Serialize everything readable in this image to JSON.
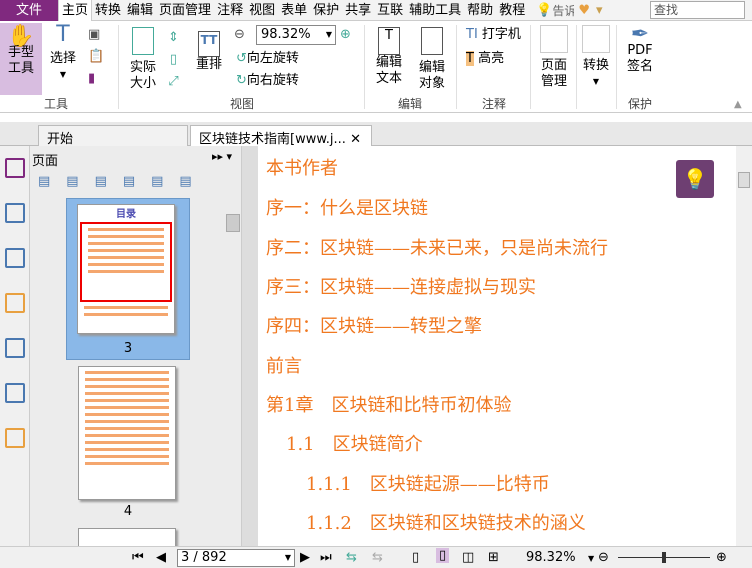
{
  "menu": {
    "file": "文件",
    "tabs": [
      "主页",
      "转换",
      "编辑",
      "页面管理",
      "注释",
      "视图",
      "表单",
      "保护",
      "共享",
      "互联",
      "辅助工具",
      "帮助",
      "教程"
    ],
    "tell": "告诉",
    "search_placeholder": "查找"
  },
  "ribbon": {
    "hand": "手型\n工具",
    "select": "选择",
    "actual": "实际\n大小",
    "reflow": "重排",
    "zoom": "98.32%",
    "rotate_left": "向左旋转",
    "rotate_right": "向右旋转",
    "edit_text": "编辑\n文本",
    "edit_object": "编辑\n对象",
    "typewriter": "打字机",
    "highlight": "高亮",
    "page_mgmt": "页面\n管理",
    "convert": "转换",
    "pdf_sign": "PDF\n签名",
    "groups": {
      "tools": "工具",
      "view": "视图",
      "edit": "编辑",
      "comment": "注释",
      "protect": "保护"
    }
  },
  "tabs": [
    {
      "label": "开始"
    },
    {
      "label": "区块链技术指南[www.j..."
    }
  ],
  "panel": {
    "title": "页面",
    "thumb_title": "目录",
    "pages": [
      "3",
      "4"
    ]
  },
  "doc": {
    "toc": [
      "本书作者",
      "序一：什么是区块链",
      "序二：区块链——未来已来，只是尚未流行",
      "序三：区块链——连接虚拟与现实",
      "序四：区块链——转型之擎",
      "前言",
      "第1章　区块链和比特币初体验",
      "1.1　区块链简介",
      "1.1.1　区块链起源——比特币",
      "1.1.2　区块链和区块链技术的涵义"
    ],
    "accent": "#f07820"
  },
  "status": {
    "page": "3 / 892",
    "zoom": "98.32%"
  }
}
